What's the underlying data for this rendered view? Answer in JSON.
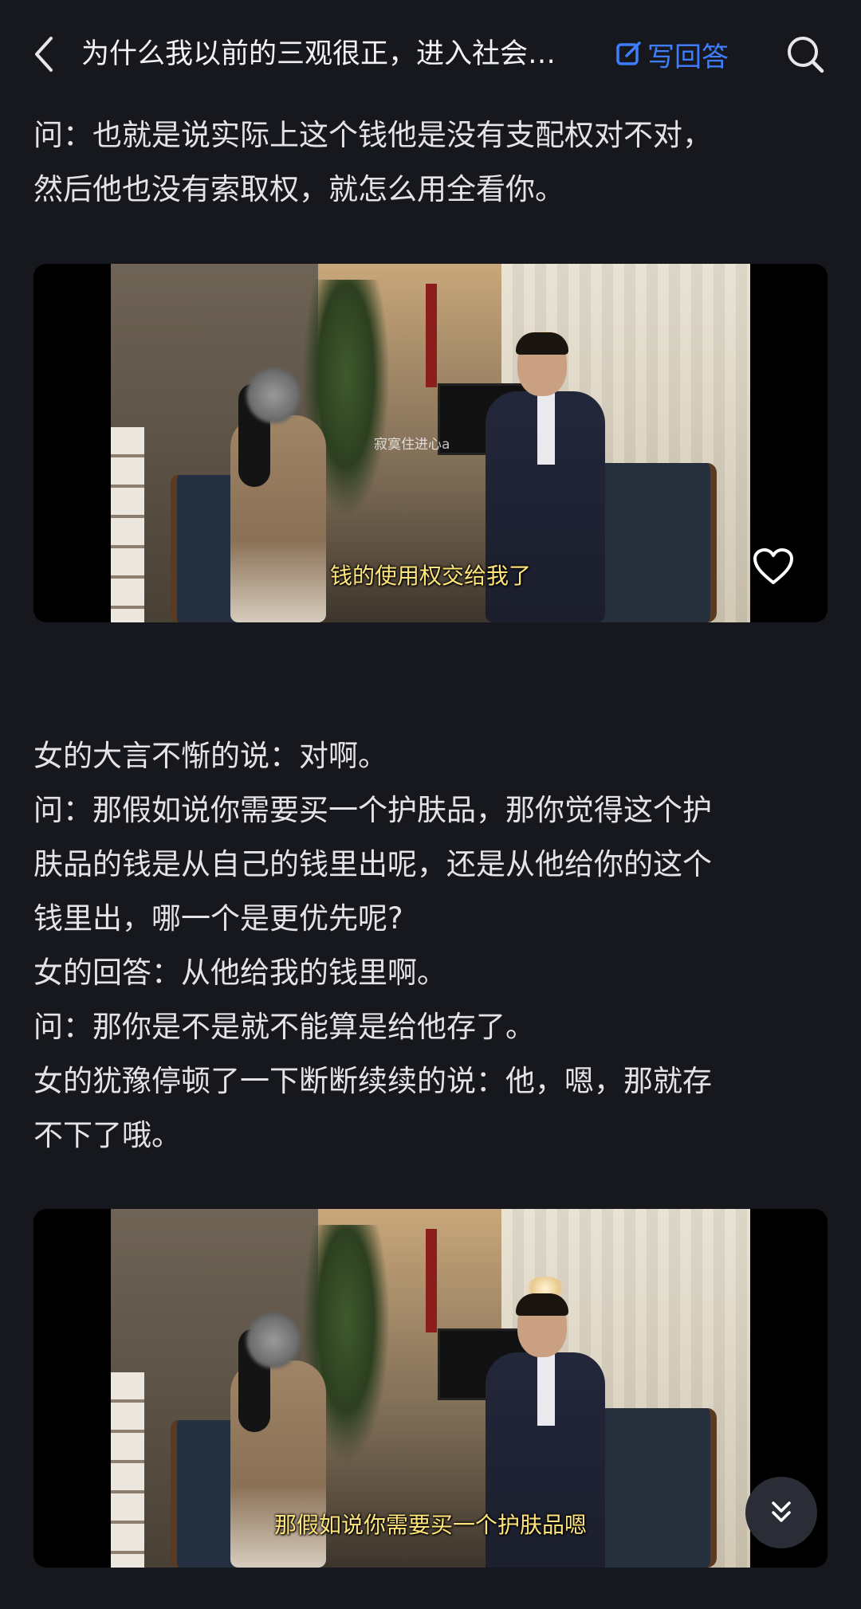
{
  "header": {
    "title": "为什么我以前的三观很正，进入社会…",
    "write_label": "写回答"
  },
  "text_blocks": {
    "block1": {
      "lines": [
        "问：也就是说实际上这个钱他是没有支配权对不对，",
        "然后他也没有索取权，就怎么用全看你。"
      ]
    },
    "block2": {
      "lines": [
        "女的大言不惭的说：对啊。",
        "问：那假如说你需要买一个护肤品，那你觉得这个护",
        "肤品的钱是从自己的钱里出呢，还是从他给你的这个",
        "钱里出，哪一个是更优先呢?",
        "女的回答：从他给我的钱里啊。",
        "问：那你是不是就不能算是给他存了。",
        "女的犹豫停顿了一下断断续续的说：他，嗯，那就存",
        "不下了哦。"
      ]
    }
  },
  "videos": [
    {
      "subtitle": "钱的使用权交给我了",
      "watermark": "寂寞住进心a"
    },
    {
      "subtitle": "那假如说你需要买一个护肤品嗯"
    }
  ],
  "icons": {
    "back": "chevron-left-icon",
    "write": "edit-icon",
    "search": "search-icon",
    "heart": "heart-icon",
    "scroll": "double-chevron-down-icon"
  },
  "colors": {
    "background": "#17181d",
    "accent": "#3f7dff",
    "subtitle": "#ffe57a"
  }
}
